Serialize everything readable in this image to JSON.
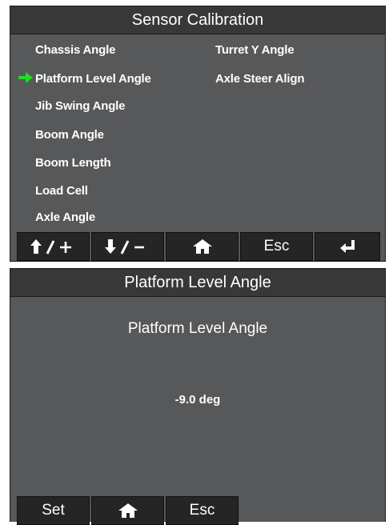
{
  "screen1": {
    "title": "Sensor Calibration",
    "menu_left": [
      "Chassis Angle",
      "Platform Level Angle",
      "Jib Swing Angle",
      "Boom Angle",
      "Boom Length",
      "Load Cell",
      "Axle Angle"
    ],
    "menu_right": [
      "Turret Y Angle",
      "Axle Steer Align"
    ],
    "selected_item": "Platform Level Angle",
    "selection_arrow_color": "#22dd22",
    "softkeys": {
      "up_plus": "↑/+",
      "down_minus": "↓/-",
      "home_icon": "home-icon",
      "esc": "Esc",
      "enter_icon": "enter-icon"
    }
  },
  "screen2": {
    "title": "Platform Level Angle",
    "heading": "Platform Level Angle",
    "value": "-9.0 deg",
    "softkeys": {
      "set": "Set",
      "home_icon": "home-icon",
      "esc": "Esc"
    }
  },
  "colors": {
    "screen_bg": "#57585a",
    "titlebar_bg": "#383838",
    "key_bg": "#252525",
    "text": "#ffffff"
  }
}
